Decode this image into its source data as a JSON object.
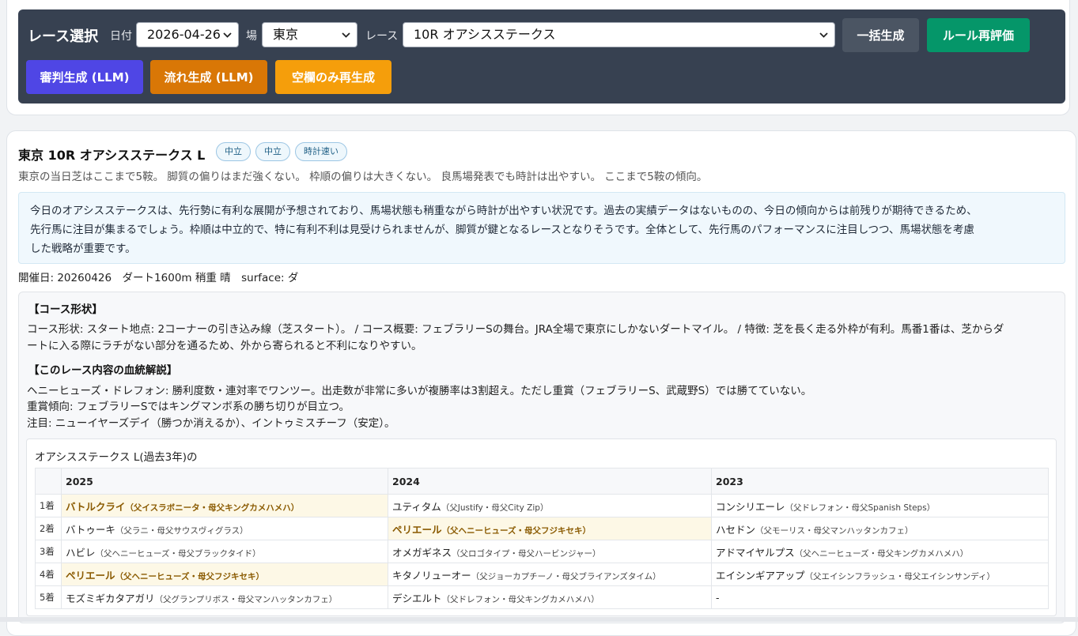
{
  "toolbar": {
    "title": "レース選択",
    "date_label": "日付",
    "date_value": "2026-04-26",
    "venue_label": "場",
    "venue_value": "東京",
    "race_label": "レース",
    "race_value": "10R オアシスステークス",
    "buttons": {
      "bulk": "一括生成",
      "rule": "ルール再評価",
      "judge": "審判生成 (LLM)",
      "flow": "流れ生成 (LLM)",
      "empty": "空欄のみ再生成"
    },
    "colors": {
      "panel": "#374151",
      "bulk": "#4b5563",
      "rule": "#059669",
      "judge": "#4f46e5",
      "flow": "#d97706",
      "empty": "#f59e0b"
    }
  },
  "race": {
    "title": "東京 10R オアシスステークス L",
    "badges": [
      "中立",
      "中立",
      "時計速い"
    ],
    "summary": "東京の当日芝はここまで5鞍。 脚質の偏りはまだ強くない。 枠順の偏りは大きくない。 良馬場発表でも時計は出やすい。 ここまで5鞍の傾向。",
    "llm_lines": [
      "今日のオアシスステークスは、先行勢に有利な展開が予想されており、馬場状態も稍重ながら時計が出やすい状況です。過去の実績データはないものの、今日の傾向からは前残りが期待できるため、",
      "先行馬に注目が集まるでしょう。枠順は中立的で、特に有利不利は見受けられませんが、脚質が鍵となるレースとなりそうです。全体として、先行馬のパフォーマンスに注目しつつ、馬場状態を考慮",
      "した戦略が重要です。"
    ],
    "meta": "開催日: 20260426　ダート1600m 稍重 晴　surface: ダ"
  },
  "course": {
    "shape_heading": "【コース形状】",
    "shape_lines": [
      "コース形状: スタート地点: 2コーナーの引き込み線（芝スタート）。 / コース概要: フェブラリーSの舞台。JRA全場で東京にしかないダートマイル。 / 特徴: 芝を長く走る外枠が有利。馬番1番は、芝からダ",
      "ートに入る際にラチがない部分を通るため、外から寄られると不利になりやすい。"
    ],
    "blood_heading": "【このレース内容の血統解説】",
    "blood_lines": [
      "ヘニーヒューズ・ドレフォン: 勝利度数・連対率でワンツー。出走数が非常に多いが複勝率は3割超え。ただし重賞（フェブラリーS、武蔵野S）では勝てていない。",
      "重賞傾向: フェブラリーSではキングマンボ系の勝ち切りが目立つ。",
      "注目: ニューイヤーズデイ（勝つか消えるか）、イントゥミスチーフ（安定）。"
    ]
  },
  "history": {
    "title": "オアシスステークス L(過去3年)の",
    "years": [
      "2025",
      "2024",
      "2023"
    ],
    "rows": [
      {
        "rank": "1着",
        "cells": [
          {
            "name": "バトルクライ",
            "sire": "（父イスラボニータ・母父キングカメハメハ）",
            "hl": true
          },
          {
            "name": "ユティタム",
            "sire": "（父Justify・母父City Zip）",
            "hl": false
          },
          {
            "name": "コンシリエーレ",
            "sire": "（父ドレフォン・母父Spanish Steps）",
            "hl": false
          }
        ]
      },
      {
        "rank": "2着",
        "cells": [
          {
            "name": "バトゥーキ",
            "sire": "（父ラニ・母父サウスヴィグラス）",
            "hl": false
          },
          {
            "name": "ペリエール",
            "sire": "（父ヘニーヒューズ・母父フジキセキ）",
            "hl": true
          },
          {
            "name": "ハセドン",
            "sire": "（父モーリス・母父マンハッタンカフェ）",
            "hl": false
          }
        ]
      },
      {
        "rank": "3着",
        "cells": [
          {
            "name": "ハビレ",
            "sire": "（父ヘニーヒューズ・母父ブラックタイド）",
            "hl": false
          },
          {
            "name": "オメガギネス",
            "sire": "（父ロゴタイプ・母父ハービンジャー）",
            "hl": false
          },
          {
            "name": "アドマイヤルプス",
            "sire": "（父ヘニーヒューズ・母父キングカメハメハ）",
            "hl": false
          }
        ]
      },
      {
        "rank": "4着",
        "cells": [
          {
            "name": "ペリエール",
            "sire": "（父ヘニーヒューズ・母父フジキセキ）",
            "hl": true
          },
          {
            "name": "キタノリューオー",
            "sire": "（父ジョーカプチーノ・母父ブライアンズタイム）",
            "hl": false
          },
          {
            "name": "エイシンギアアップ",
            "sire": "（父エイシンフラッシュ・母父エイシンサンディ）",
            "hl": false
          }
        ]
      },
      {
        "rank": "5着",
        "cells": [
          {
            "name": "モズミギカタアガリ",
            "sire": "（父グランプリボス・母父マンハッタンカフェ）",
            "hl": false
          },
          {
            "name": "デシエルト",
            "sire": "（父ドレフォン・母父キングカメハメハ）",
            "hl": false
          },
          {
            "name": "-",
            "sire": "",
            "hl": false
          }
        ]
      }
    ]
  }
}
